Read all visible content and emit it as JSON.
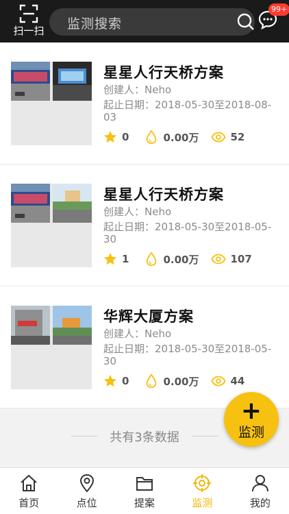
{
  "header": {
    "scan_label": "扫一扫",
    "search_placeholder": "监测搜索",
    "badge": "99+"
  },
  "items": [
    {
      "title": "星星人行天桥方案",
      "creator": "创建人：Neho",
      "dates": "起止日期：2018-05-30至2018-08-03",
      "stars": "0",
      "amount": "0.00万",
      "views": "52"
    },
    {
      "title": "星星人行天桥方案",
      "creator": "创建人：Neho",
      "dates": "起止日期：2018-05-30至2018-05-30",
      "stars": "1",
      "amount": "0.00万",
      "views": "107"
    },
    {
      "title": "华辉大厦方案",
      "creator": "创建人：Neho",
      "dates": "起止日期：2018-05-30至2018-05-30",
      "stars": "0",
      "amount": "0.00万",
      "views": "44"
    }
  ],
  "total_text": "共有3条数据",
  "fab": {
    "plus": "+",
    "label": "监测"
  },
  "tabs": [
    {
      "label": "首页",
      "icon": "home-icon"
    },
    {
      "label": "点位",
      "icon": "location-pin-icon"
    },
    {
      "label": "提案",
      "icon": "folder-icon"
    },
    {
      "label": "监测",
      "icon": "target-icon",
      "active": true
    },
    {
      "label": "我的",
      "icon": "user-icon"
    }
  ],
  "colors": {
    "accent": "#f7c112",
    "active_tab": "#f2b705",
    "header_bg": "#1a1a1a",
    "badge": "#ff3b30"
  }
}
